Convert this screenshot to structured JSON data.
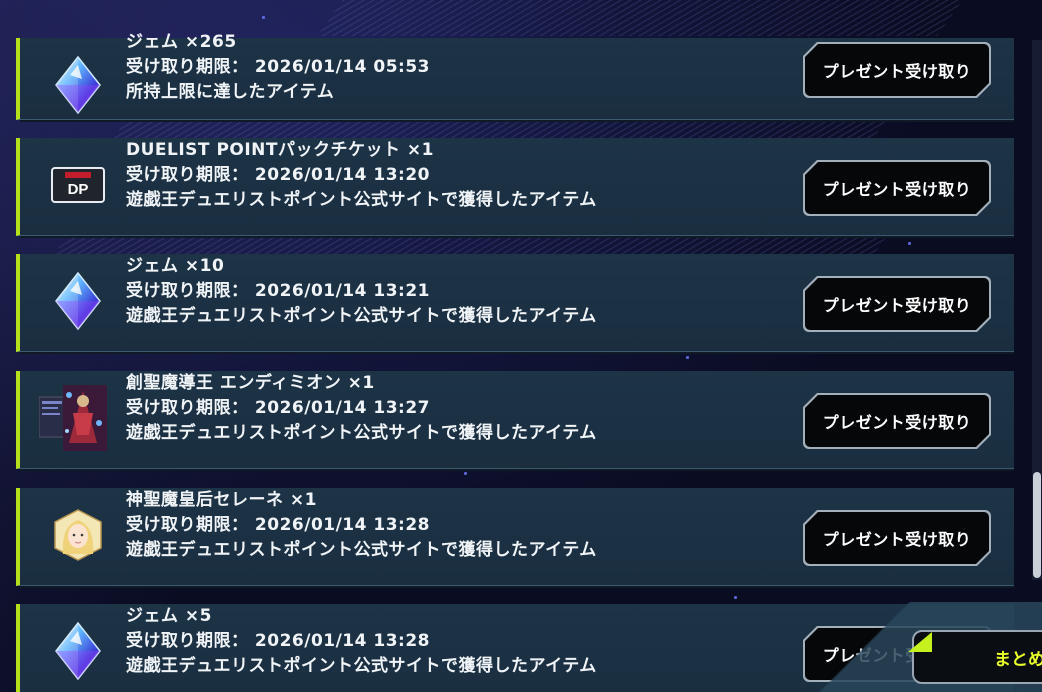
{
  "items": [
    {
      "icon": "gem-icon",
      "line1": "ジェム ×265",
      "line2": "受け取り期限： 2026/01/14 05:53",
      "line3": "所持上限に達したアイテム",
      "button": "プレゼント受け取り"
    },
    {
      "icon": "dp-ticket-icon",
      "icon_text": "DP",
      "line1": "DUELIST POINTパックチケット ×1",
      "line2": "受け取り期限： 2026/01/14 13:20",
      "line3": "遊戯王デュエリストポイント公式サイトで獲得したアイテム",
      "button": "プレゼント受け取り"
    },
    {
      "icon": "gem-icon",
      "line1": "ジェム ×10",
      "line2": "受け取り期限： 2026/01/14 13:21",
      "line3": "遊戯王デュエリストポイント公式サイトで獲得したアイテム",
      "button": "プレゼント受け取り"
    },
    {
      "icon": "card-sleeve-icon",
      "line1": "創聖魔導王 エンディミオン ×1",
      "line2": "受け取り期限： 2026/01/14 13:27",
      "line3": "遊戯王デュエリストポイント公式サイトで獲得したアイテム",
      "button": "プレゼント受け取り"
    },
    {
      "icon": "avatar-icon",
      "line1": "神聖魔皇后セレーネ ×1",
      "line2": "受け取り期限： 2026/01/14 13:28",
      "line3": "遊戯王デュエリストポイント公式サイトで獲得したアイテム",
      "button": "プレゼント受け取り"
    },
    {
      "icon": "gem-icon",
      "line1": "ジェム ×5",
      "line2": "受け取り期限： 2026/01/14 13:28",
      "line3": "遊戯王デュエリストポイント公式サイトで獲得したアイテム",
      "button": "プレゼント受け取り"
    }
  ],
  "bulk_button": "まとめ",
  "colors": {
    "accent": "#b6e01c",
    "row_bg": "#1b3043",
    "bulk_text": "#e8ff2a"
  }
}
